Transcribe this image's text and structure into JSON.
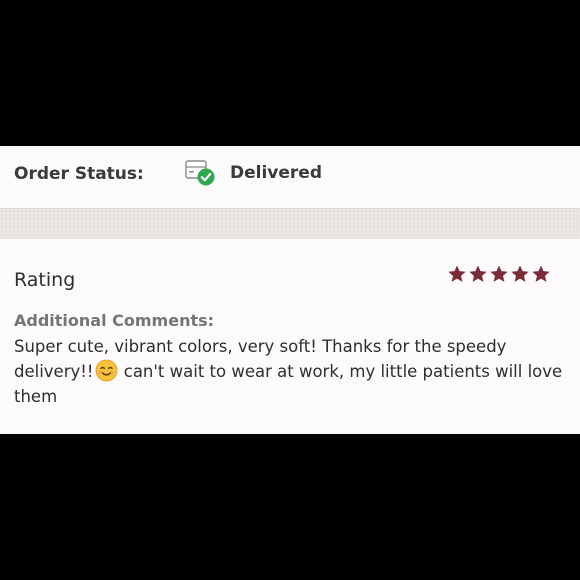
{
  "order_status": {
    "label": "Order Status:",
    "value": "Delivered",
    "icon": "package-delivered-icon"
  },
  "review": {
    "rating_label": "Rating",
    "rating_value": 5,
    "rating_max": 5,
    "star_color": "#7a2b38",
    "comments_label": "Additional Comments:",
    "comment_part1": "Super cute, vibrant colors, very soft! Thanks for the speedy delivery!!",
    "comment_emoji": "smiling-face-emoji",
    "comment_part2": " can't wait to wear at work, my little patients will love them"
  },
  "colors": {
    "card_background": "#fcfafa",
    "separator": "#ebe8e4",
    "check_green": "#2fa84f"
  }
}
